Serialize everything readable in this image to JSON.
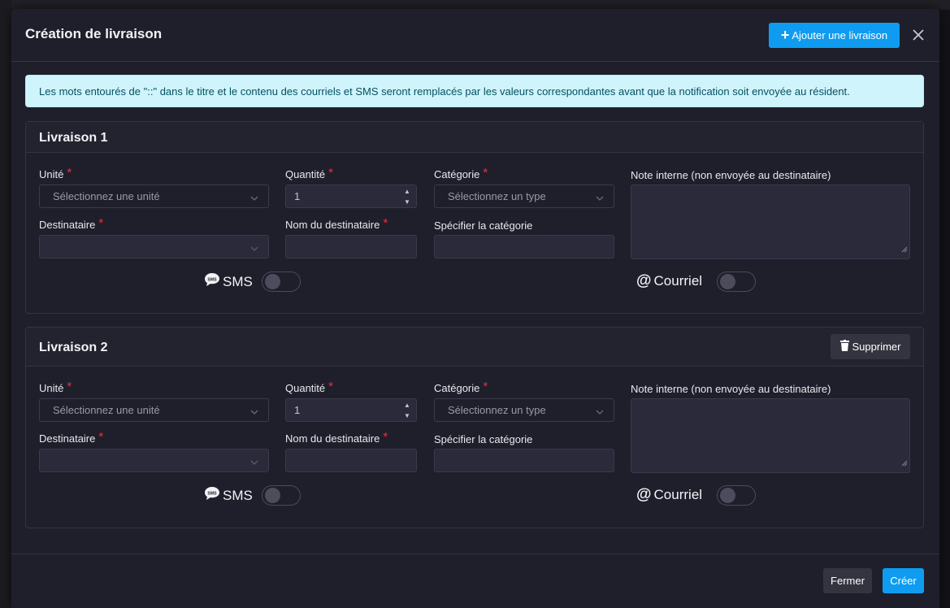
{
  "modal": {
    "title": "Création de livraison",
    "add_button": "Ajouter une livraison",
    "info": "Les mots entourés de \"::\" dans le titre et le contenu des courriels et SMS seront remplacés par les valeurs correspondantes avant que la notification soit envoyée au résident."
  },
  "deliveries": [
    {
      "title": "Livraison 1",
      "unit_label": "Unité",
      "unit_placeholder": "Sélectionnez une unité",
      "quantity_label": "Quantité",
      "quantity_value": "1",
      "category_label": "Catégorie",
      "category_placeholder": "Sélectionnez un type",
      "note_label": "Note interne (non envoyée au destinataire)",
      "recipient_label": "Destinataire",
      "recipient_name_label": "Nom du destinataire",
      "specify_category_label": "Spécifier la catégorie",
      "sms_label": "SMS",
      "email_label": "Courriel",
      "sms_enabled": false,
      "email_enabled": false
    },
    {
      "title": "Livraison 2",
      "delete_button": "Supprimer",
      "unit_label": "Unité",
      "unit_placeholder": "Sélectionnez une unité",
      "quantity_label": "Quantité",
      "quantity_value": "1",
      "category_label": "Catégorie",
      "category_placeholder": "Sélectionnez un type",
      "note_label": "Note interne (non envoyée au destinataire)",
      "recipient_label": "Destinataire",
      "recipient_name_label": "Nom du destinataire",
      "specify_category_label": "Spécifier la catégorie",
      "sms_label": "SMS",
      "email_label": "Courriel",
      "sms_enabled": false,
      "email_enabled": false
    }
  ],
  "footer": {
    "close_button": "Fermer",
    "create_button": "Créer"
  },
  "colors": {
    "primary": "#0f9cf0",
    "required": "#e8313d",
    "info_bg": "#cff4fc",
    "info_text": "#055160"
  }
}
